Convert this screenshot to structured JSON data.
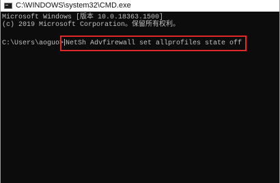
{
  "window": {
    "title": "C:\\WINDOWS\\system32\\CMD.exe",
    "icon": "console-icon"
  },
  "console": {
    "banner_line_1": "Microsoft Windows [版本 10.0.18363.1500]",
    "banner_line_2": "(c) 2019 Microsoft Corporation。保留所有权利。",
    "prompt": "C:\\Users\\aoguo>",
    "command": "NetSh Advfirewall set allprofiles state off"
  },
  "colors": {
    "console_background": "#0c0c0c",
    "console_text": "#c0c0c0",
    "highlight_box": "#e3282b",
    "titlebar": "#ffffff"
  }
}
